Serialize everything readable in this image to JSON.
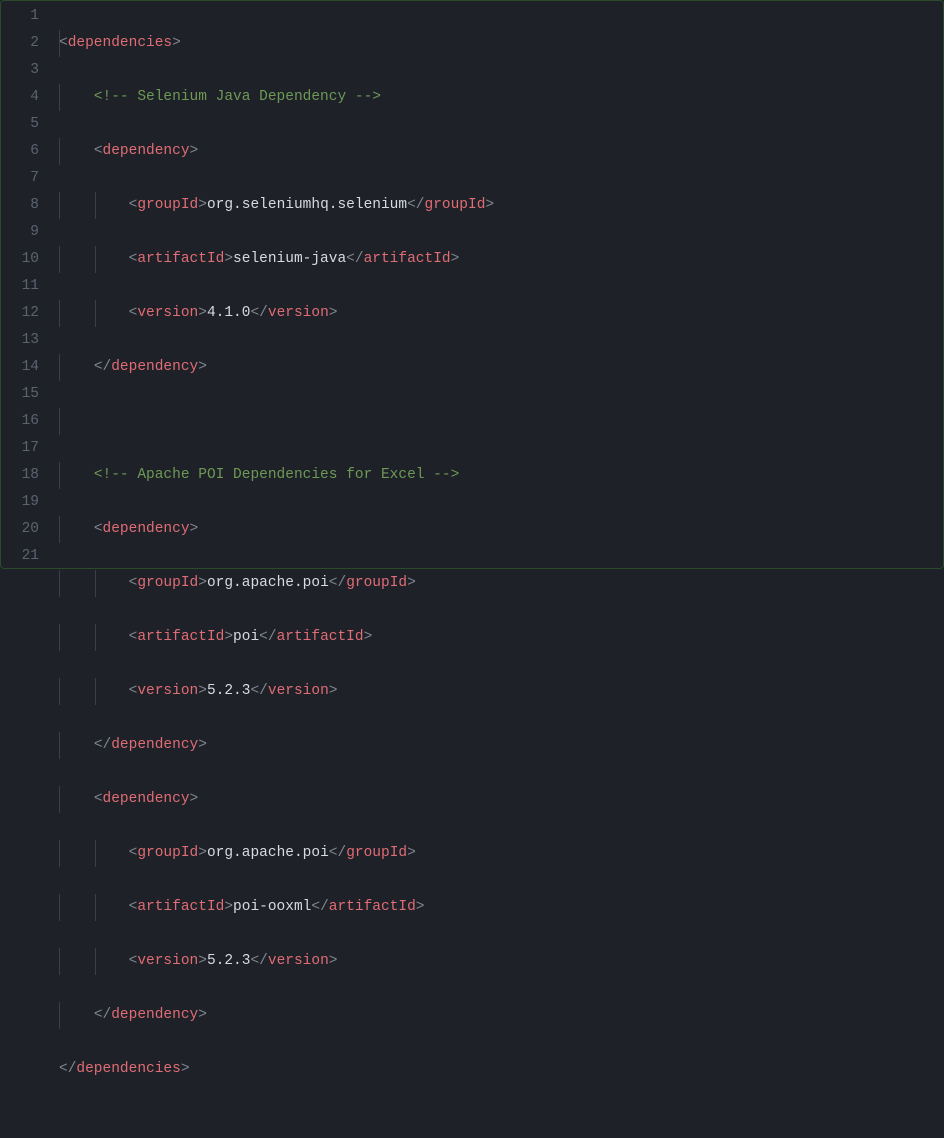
{
  "lineNumbers": [
    "1",
    "2",
    "3",
    "4",
    "5",
    "6",
    "7",
    "8",
    "9",
    "10",
    "11",
    "12",
    "13",
    "14",
    "15",
    "16",
    "17",
    "18",
    "19",
    "20",
    "21"
  ],
  "tokens": {
    "dependencies": "dependencies",
    "dependency": "dependency",
    "groupId": "groupId",
    "artifactId": "artifactId",
    "version": "version",
    "lt": "<",
    "gt": ">",
    "slash": "/",
    "cmtOpen": "<!-- ",
    "cmtClose": " -->"
  },
  "comments": {
    "selenium": "Selenium Java Dependency",
    "poi": "Apache POI Dependencies for Excel"
  },
  "values": {
    "seleniumGroup": "org.seleniumhq.selenium",
    "seleniumArtifact": "selenium-java",
    "seleniumVersion": "4.1.0",
    "poiGroup": "org.apache.poi",
    "poiArtifact": "poi",
    "poiVersion": "5.2.3",
    "poiOoxmlArtifact": "poi-ooxml",
    "poiOoxmlVersion": "5.2.3"
  }
}
